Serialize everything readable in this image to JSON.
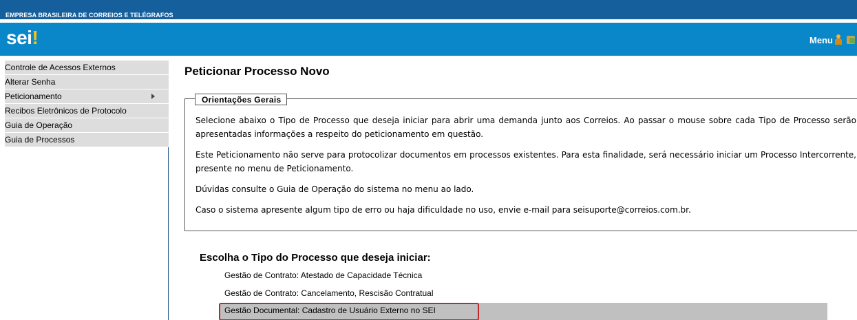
{
  "header": {
    "org_name": "EMPRESA BRASILEIRA DE CORREIOS E TELÉGRAFOS",
    "logo_text": "sei",
    "logo_mark": "!",
    "menu_label": "Menu",
    "colors": {
      "top": "#155f9c",
      "brand": "#0a87c9",
      "logo_accent": "#ffc20e"
    }
  },
  "sidebar": {
    "items": [
      {
        "label": "Controle de Acessos Externos"
      },
      {
        "label": "Alterar Senha"
      },
      {
        "label": "Peticionamento",
        "has_submenu": true
      },
      {
        "label": "Recibos Eletrônicos de Protocolo"
      },
      {
        "label": "Guia de Operação"
      },
      {
        "label": "Guia de Processos"
      }
    ]
  },
  "main": {
    "title": "Peticionar Processo Novo",
    "guidelines": {
      "legend": "Orientações Gerais",
      "paragraphs": [
        "Selecione abaixo o Tipo de Processo que deseja iniciar para abrir uma demanda junto aos Correios. Ao passar o mouse sobre cada Tipo de Processo serão apresentadas informações a respeito do peticionamento em questão.",
        "Este Peticionamento não serve para protocolizar documentos em processos existentes. Para esta finalidade, será necessário iniciar um Processo Intercorrente, presente no menu de Peticionamento.",
        "Dúvidas consulte o Guia de Operação do sistema no menu ao lado.",
        "Caso o sistema apresente algum tipo de erro ou haja dificuldade no uso, envie e-mail para seisuporte@correios.com.br."
      ]
    },
    "choose_title": "Escolha o Tipo do Processo que deseja iniciar:",
    "process_types": [
      {
        "label": "Gestão de Contrato: Atestado de Capacidade Técnica"
      },
      {
        "label": "Gestão de Contrato: Cancelamento, Rescisão Contratual"
      },
      {
        "label": "Gestão Documental: Cadastro de Usuário Externo no SEI",
        "highlighted": true
      }
    ]
  }
}
